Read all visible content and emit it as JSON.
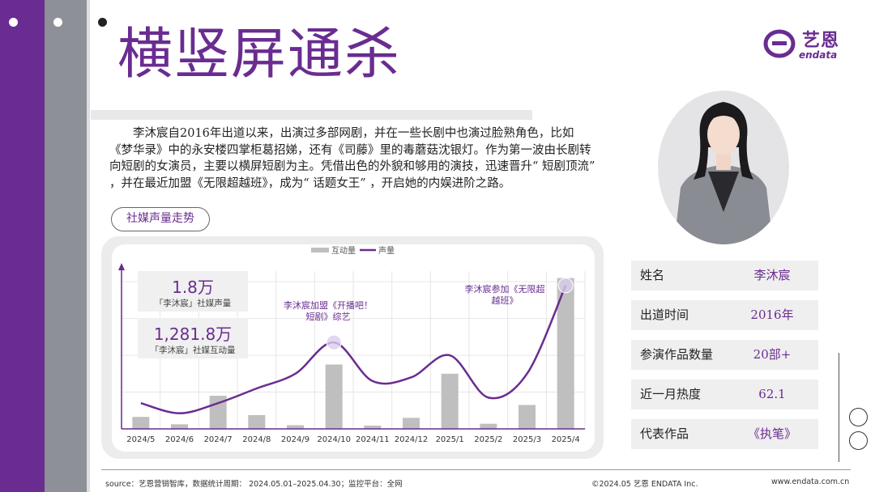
{
  "title": "横竖屏通杀",
  "logo": {
    "cn": "艺恩",
    "en": "endata",
    "icon": "endata-e-logo-icon"
  },
  "intro": "李沐宸自2016年出道以来，出演过多部网剧，并在一些长剧中也演过脸熟角色，比如《梦华录》中的永安楼四掌柜葛招娣，还有《司藤》里的毒蘑菇沈银灯。作为第一波由长剧转向短剧的女演员，主要以横屏短剧为主。凭借出色的外貌和够用的演技，迅速晋升“ 短剧顶流” ，并在最近加盟《无限超越班》，成为“ 话题女王” ，开启她的内娱进阶之路。",
  "section_tag": "社媒声量走势",
  "stats": [
    {
      "value": "1.8万",
      "label": "「李沐宸」社媒声量"
    },
    {
      "value": "1,281.8万",
      "label": "「李沐宸」社媒互动量"
    }
  ],
  "annotations": [
    {
      "text_line1": "李沐宸加盟《开播吧！",
      "text_line2": "短剧》综艺"
    },
    {
      "text_line1": "李沐宸参加《无限超",
      "text_line2": "越班》"
    }
  ],
  "chart_data": {
    "type": "bar",
    "categories": [
      "2024/5",
      "2024/6",
      "2024/7",
      "2024/8",
      "2024/9",
      "2024/10",
      "2024/11",
      "2024/12",
      "2025/1",
      "2025/2",
      "2025/3",
      "2025/4"
    ],
    "series": [
      {
        "name": "互动量",
        "type": "bar",
        "values": [
          6.5,
          2.5,
          18,
          7.5,
          2,
          35,
          1.8,
          6,
          30,
          2.8,
          13,
          82
        ]
      },
      {
        "name": "声量",
        "type": "line",
        "values": [
          14,
          8.5,
          14,
          22,
          30,
          47,
          26,
          28,
          40,
          17,
          30,
          78
        ]
      }
    ],
    "ylim": [
      0,
      88
    ],
    "legend_position": "top-center",
    "grid": true,
    "colors": {
      "bar": "#bfbfbf",
      "line": "#6a2c91",
      "marker": "#d9cdeb"
    }
  },
  "info_table": [
    {
      "label": "姓名",
      "value": "李沐宸"
    },
    {
      "label": "出道时间",
      "value": "2016年"
    },
    {
      "label": "参演作品数量",
      "value": "20部+"
    },
    {
      "label": "近一月热度",
      "value": "62.1"
    },
    {
      "label": "代表作品",
      "value": "《执笔》"
    }
  ],
  "footer": {
    "source": "source：艺恩营销智库，数据统计周期：  2024.05.01–2025.04.30；监控平台：全网",
    "copyright": "©2024.05  艺恩  ENDATA Inc.",
    "website": "www.endata.com.cn"
  },
  "colors": {
    "brand": "#6a2c91",
    "gray_strip": "#8d9096"
  }
}
